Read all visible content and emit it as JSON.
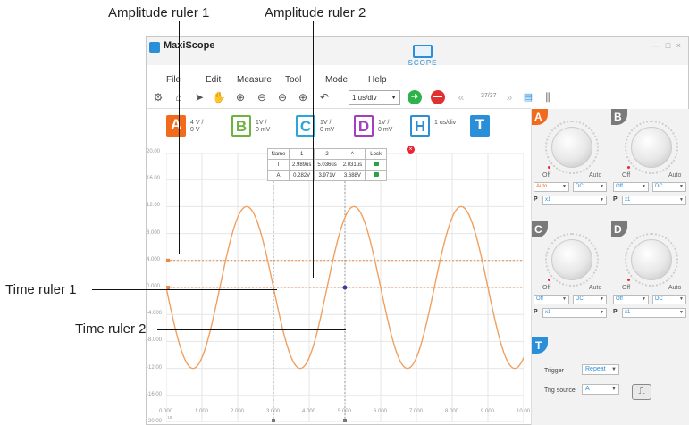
{
  "annotations": {
    "amplitude_ruler_1": "Amplitude ruler 1",
    "amplitude_ruler_2": "Amplitude ruler 2",
    "time_ruler_1": "Time ruler 1",
    "time_ruler_2": "Time ruler 2"
  },
  "app": {
    "title": "MaxiScope",
    "scope_button": "SCOPE",
    "window_controls": "— □ ×"
  },
  "menu": [
    "File",
    "Edit",
    "Measure",
    "Tool",
    "Mode",
    "Help"
  ],
  "toolbar": {
    "icons": [
      "settings-icon",
      "home-icon",
      "pointer-icon",
      "hand-icon",
      "zoom-in-icon",
      "zoom-out-icon",
      "zoom-out-y-icon",
      "zoom-x-icon",
      "undo-icon"
    ],
    "timebase": "1 us/div",
    "frame_count": "37/37"
  },
  "channels": [
    {
      "id": "A",
      "color": "#f26b1d",
      "filled": true,
      "line1": "4 V /",
      "line2": "0 V"
    },
    {
      "id": "B",
      "color": "#6cb33f",
      "filled": false,
      "line1": "1V /",
      "line2": "0 mV"
    },
    {
      "id": "C",
      "color": "#2ba7d6",
      "filled": false,
      "line1": "1V /",
      "line2": "0 mV"
    },
    {
      "id": "D",
      "color": "#a33fbf",
      "filled": false,
      "line1": "1V /",
      "line2": "0 mV"
    },
    {
      "id": "H",
      "color": "#2a8fd8",
      "filled": false,
      "line1": "1 us/div",
      "line2": ""
    },
    {
      "id": "T",
      "color": "#2a8fd8",
      "filled": true,
      "line1": "",
      "line2": ""
    }
  ],
  "measure_table": {
    "headers": [
      "Name",
      "1",
      "2",
      "^",
      "Lock"
    ],
    "rows": [
      [
        "T",
        "2.989us",
        "5.036us",
        "2.031us"
      ],
      [
        "A",
        "0.282V",
        "3.971V",
        "3.688V"
      ]
    ]
  },
  "chart_data": {
    "type": "line",
    "yticks": [
      "20.00",
      "16.00",
      "12.00",
      "8.000",
      "4.000",
      "0.000",
      "-4.000",
      "-8.000",
      "-12.00",
      "-16.00",
      "-20.00"
    ],
    "xticks": [
      "0.000",
      "1.000",
      "2.000",
      "3.000",
      "4.000",
      "5.000",
      "6.000",
      "7.000",
      "8.000",
      "9.000",
      "10.00"
    ],
    "xunit": "us",
    "xlim": [
      0,
      10
    ],
    "ylim": [
      -20,
      20
    ],
    "series": [
      {
        "color": "#f0a060",
        "amplitude": 12,
        "period_us": 3.0,
        "phase_deg": 180
      }
    ],
    "amplitude_rulers": [
      4.0,
      0.0
    ],
    "time_rulers": [
      3.0,
      5.0
    ]
  },
  "right_panel": {
    "channels": [
      {
        "id": "A",
        "color": "#f26b1d",
        "off": "Off",
        "auto": "Auto",
        "coupling_mode": "Auto",
        "coupling": "DC",
        "probe": "x1"
      },
      {
        "id": "B",
        "color": "#7a7a7a",
        "off": "Off",
        "auto": "Auto",
        "coupling_mode": "Off",
        "coupling": "DC",
        "probe": "x1"
      },
      {
        "id": "C",
        "color": "#7a7a7a",
        "off": "Off",
        "auto": "Auto",
        "coupling_mode": "Off",
        "coupling": "DC",
        "probe": "x1"
      },
      {
        "id": "D",
        "color": "#7a7a7a",
        "off": "Off",
        "auto": "Auto",
        "coupling_mode": "Off",
        "coupling": "DC",
        "probe": "x1"
      }
    ],
    "probe_label": "P",
    "trigger": {
      "tag": "T",
      "trigger_label": "Trigger",
      "trigger_value": "Repeat",
      "source_label": "Trig source",
      "source_value": "A"
    }
  }
}
